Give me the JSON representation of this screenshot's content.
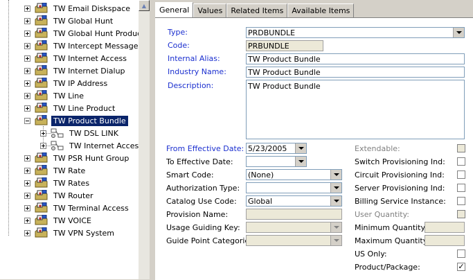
{
  "tree": {
    "items": [
      {
        "label": "TW Email Diskspace"
      },
      {
        "label": "TW Global Hunt"
      },
      {
        "label": "TW Global Hunt Product"
      },
      {
        "label": "TW Intercept Message"
      },
      {
        "label": "TW Internet Access"
      },
      {
        "label": "TW Internet Dialup"
      },
      {
        "label": "TW IP Address"
      },
      {
        "label": "TW Line"
      },
      {
        "label": "TW Line Product"
      },
      {
        "label": "TW Product Bundle"
      },
      {
        "label": "TW DSL LINK"
      },
      {
        "label": "TW Internet Access"
      },
      {
        "label": "TW PSR Hunt Group"
      },
      {
        "label": "TW Rate"
      },
      {
        "label": "TW Rates"
      },
      {
        "label": "TW Router"
      },
      {
        "label": "TW Terminal Access"
      },
      {
        "label": "TW VOICE"
      },
      {
        "label": "TW VPN System"
      }
    ]
  },
  "tabs": [
    "General",
    "Values",
    "Related Items",
    "Available Items"
  ],
  "form": {
    "type_label": "Type:",
    "type_value": "PRDBUNDLE",
    "code_label": "Code:",
    "code_value": "PRBUNDLE",
    "alias_label": "Internal Alias:",
    "alias_value": "TW Product Bundle",
    "industry_label": "Industry Name:",
    "industry_value": "TW Product Bundle",
    "desc_label": "Description:",
    "desc_value": "TW Product Bundle",
    "from_date_label": "From Effective Date:",
    "from_date_value": "5/23/2005",
    "to_date_label": "To Effective Date:",
    "to_date_value": "",
    "smart_code_label": "Smart Code:",
    "smart_code_value": "(None)",
    "auth_type_label": "Authorization Type:",
    "auth_type_value": "",
    "catalog_label": "Catalog Use Code:",
    "catalog_value": "Global",
    "provision_name_label": "Provision Name:",
    "provision_name_value": "",
    "usage_label": "Usage Guiding Key:",
    "usage_value": "",
    "guide_label": "Guide Point Categories:",
    "guide_value": ""
  },
  "right": {
    "extendable": "Extendable:",
    "switch_prov": "Switch Provisioning Ind:",
    "circuit_prov": "Circuit Provisioning Ind:",
    "server_prov": "Server Provisioning Ind:",
    "billing": "Billing Service Instance:",
    "user_qty": "User Quantity:",
    "min_qty": "Minimum Quantity:",
    "max_qty": "Maximum Quantity",
    "us_only": "US Only:",
    "product_package": "Product/Package:",
    "product_package_checked": "✓"
  },
  "colors": {
    "accent": "#1a2ecf",
    "selection": "#0a246a"
  }
}
